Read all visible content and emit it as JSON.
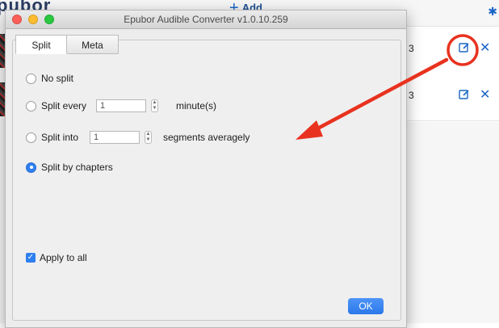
{
  "background_app": {
    "logo_text": "pubor",
    "add_label": "Add",
    "rows": [
      {
        "duration": "3"
      },
      {
        "duration": "3"
      }
    ]
  },
  "dialog": {
    "title": "Epubor Audible Converter v1.0.10.259",
    "tabs": [
      {
        "label": "Split",
        "active": true
      },
      {
        "label": "Meta",
        "active": false
      }
    ],
    "options": {
      "no_split": {
        "label": "No split"
      },
      "split_every": {
        "label": "Split every",
        "value": "1",
        "unit": "minute(s)"
      },
      "split_into": {
        "label": "Split into",
        "value": "1",
        "unit": "segments averagely"
      },
      "split_by_chapters": {
        "label": "Split by chapters"
      }
    },
    "selected_option": "split_by_chapters",
    "apply_to_all": {
      "label": "Apply to all",
      "checked": true
    },
    "ok_label": "OK"
  },
  "annotation": {
    "color": "#e8321f"
  },
  "colors": {
    "accent": "#2f7ff0",
    "icon_blue": "#1a66c6"
  }
}
